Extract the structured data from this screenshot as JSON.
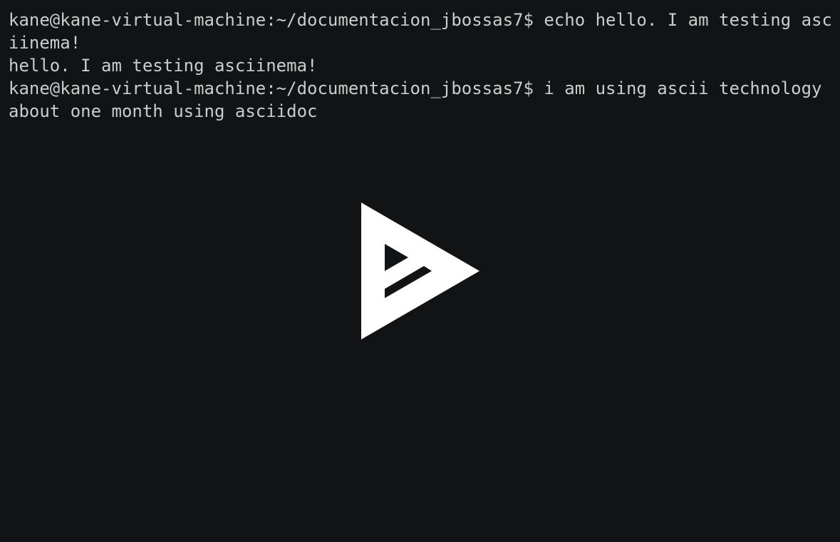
{
  "terminal": {
    "lines": [
      "kane@kane-virtual-machine:~/documentacion_jbossas7$ echo hello. I am testing asc",
      "iinema!",
      "hello. I am testing asciinema!",
      "kane@kane-virtual-machine:~/documentacion_jbossas7$ i am using ascii technology",
      "about one month using asciidoc"
    ]
  },
  "overlay": {
    "icon": "asciinema-play-icon"
  },
  "colors": {
    "background": "#121314",
    "text": "#cccccc",
    "play_icon": "#ffffff"
  }
}
